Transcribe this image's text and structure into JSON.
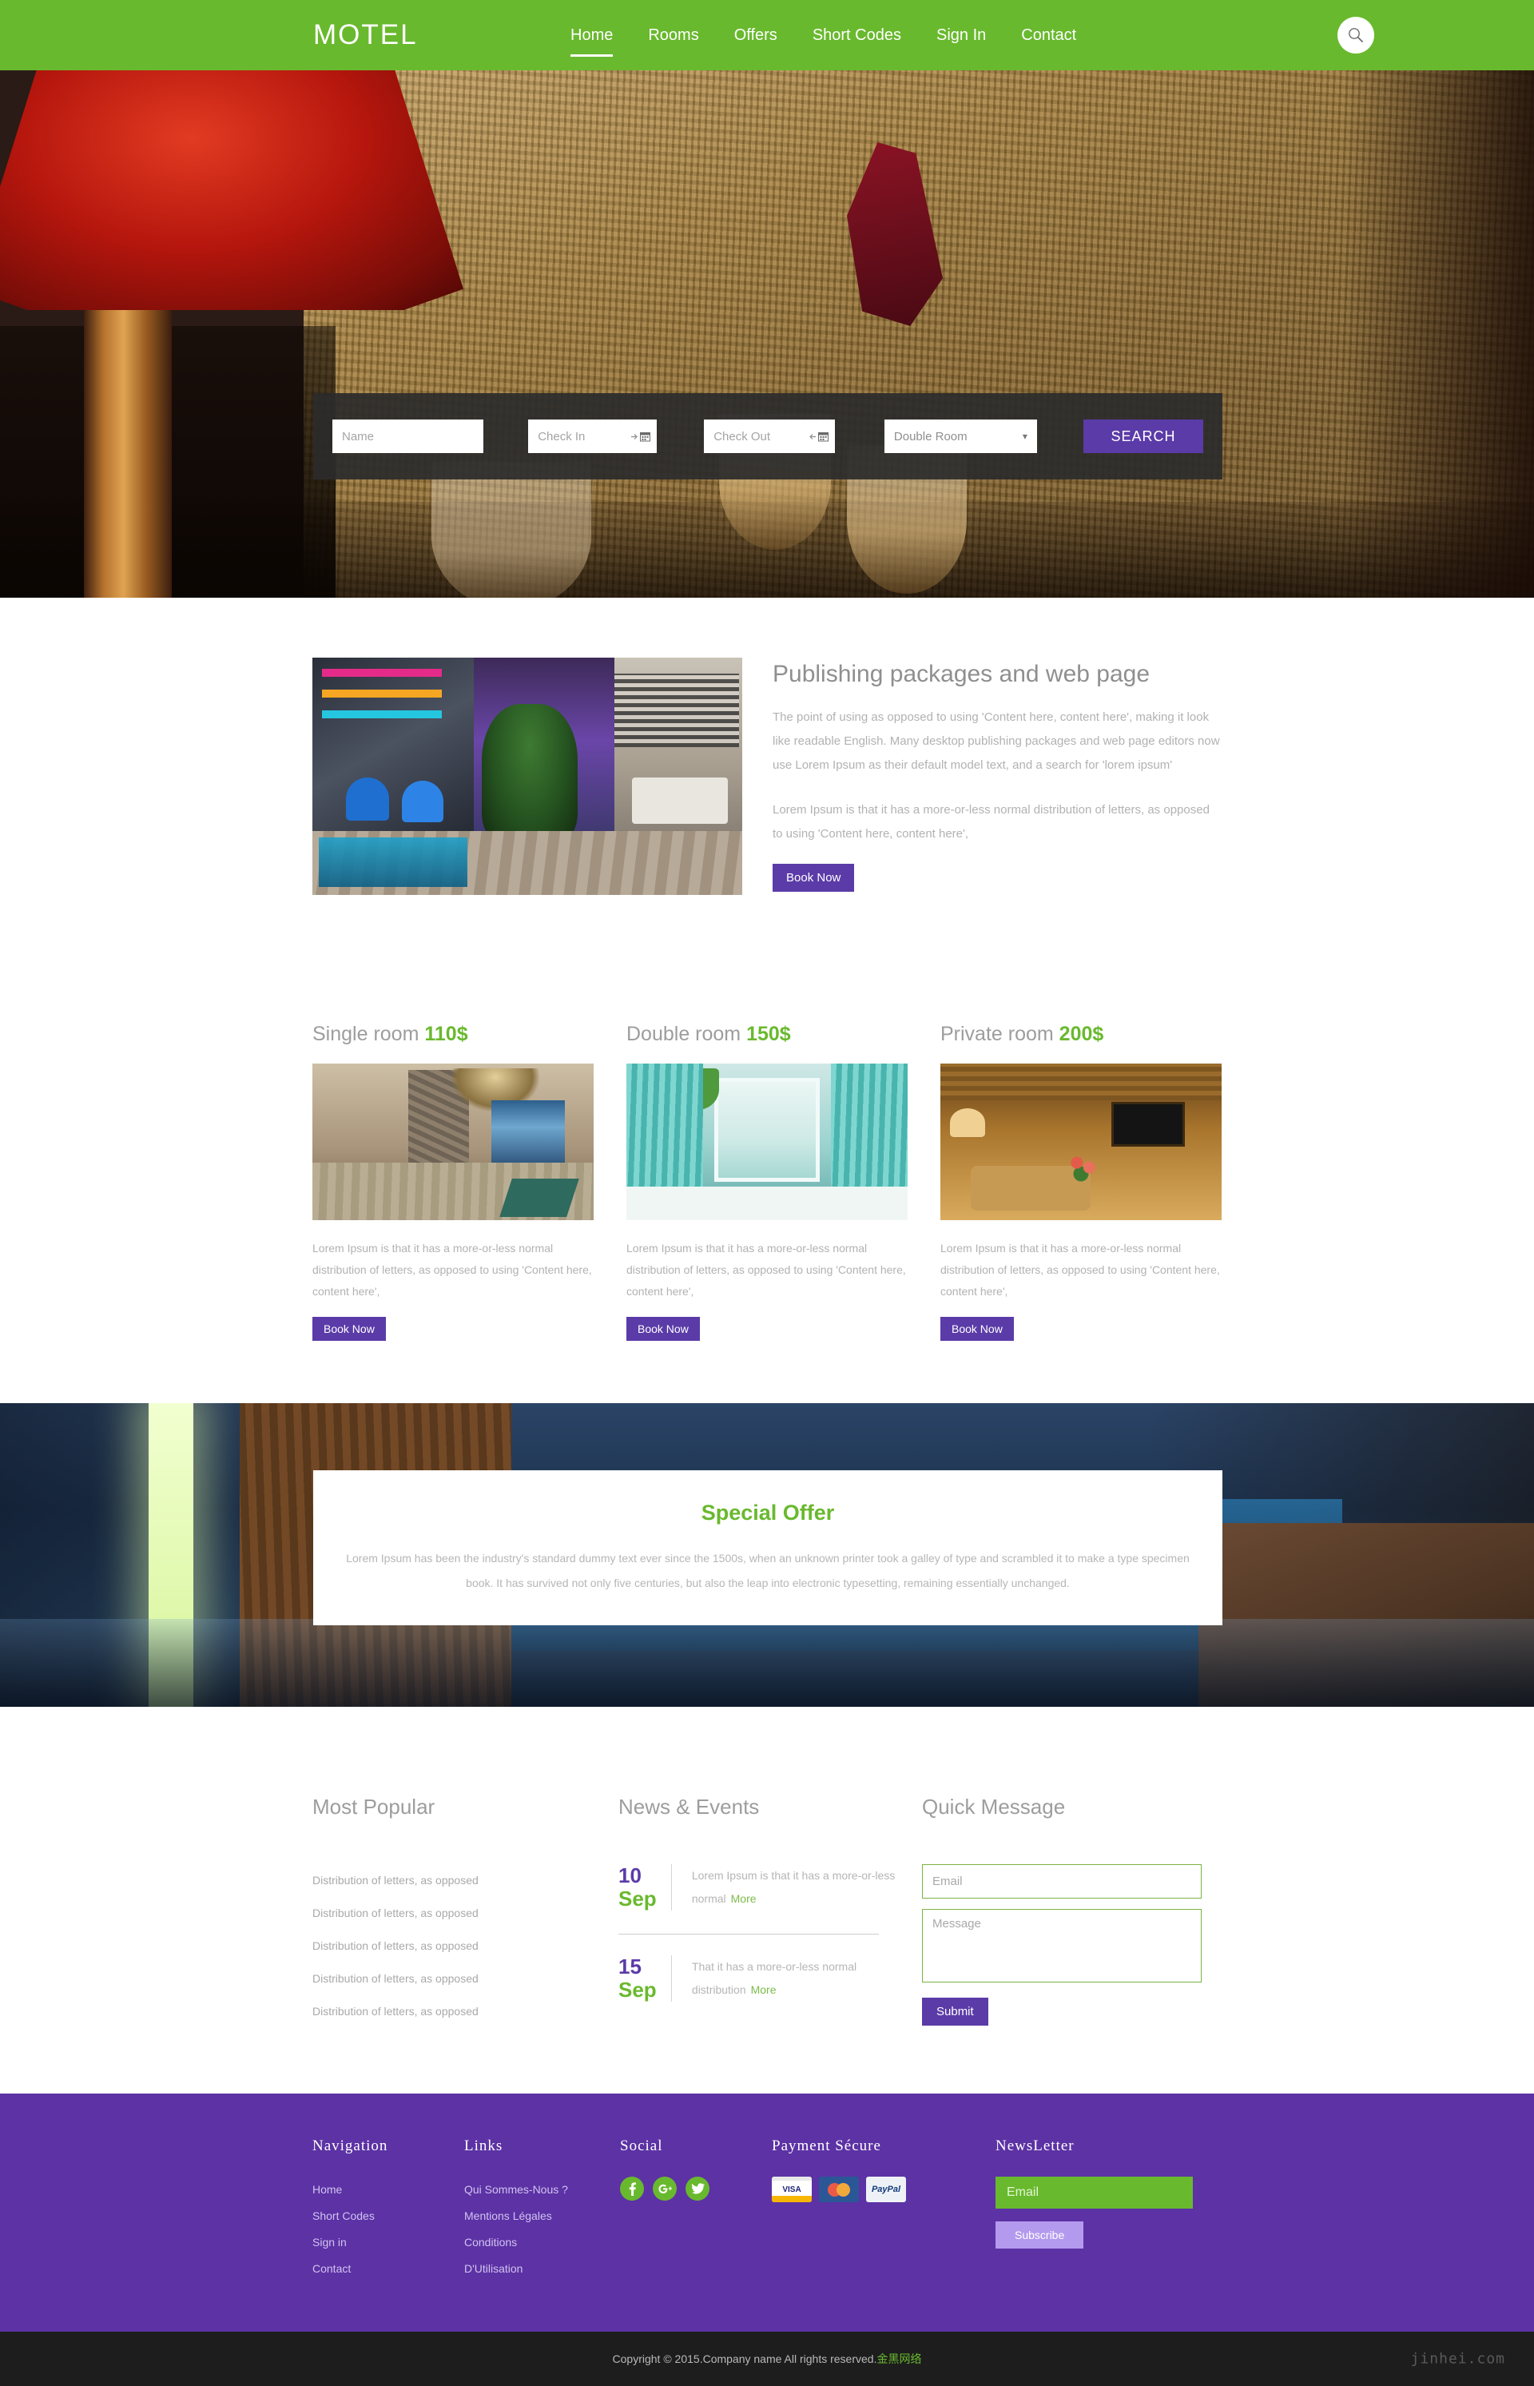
{
  "header": {
    "brand": "MOTEL",
    "nav": [
      {
        "label": "Home",
        "active": true
      },
      {
        "label": "Rooms",
        "active": false
      },
      {
        "label": "Offers",
        "active": false
      },
      {
        "label": "Short Codes",
        "active": false
      },
      {
        "label": "Sign In",
        "active": false
      },
      {
        "label": "Contact",
        "active": false
      }
    ],
    "search_icon": "search-icon",
    "accent_green": "#69b92e"
  },
  "booking": {
    "name_placeholder": "Name",
    "checkin_placeholder": "Check In",
    "checkout_placeholder": "Check Out",
    "room_selected": "Double Room",
    "room_options": [
      "Double Room"
    ],
    "search_label": "SEARCH",
    "calendar_icon": "calendar-icon",
    "chevron_icon": "chevron-down-icon"
  },
  "about": {
    "title": "Publishing packages and web page",
    "paragraph1": "The point of using as opposed to using 'Content here, content here', making it look like readable English. Many desktop publishing packages and web page editors now use Lorem Ipsum as their default model text, and a search for 'lorem ipsum'",
    "paragraph2": "Lorem Ipsum is that it has a more-or-less normal distribution of letters, as opposed to using 'Content here, content here',",
    "book_label": "Book Now"
  },
  "rooms": [
    {
      "name": "Single room",
      "price": "110$",
      "desc": "Lorem Ipsum is that it has a more-or-less normal distribution of letters, as opposed to using 'Content here, content here',",
      "book_label": "Book Now"
    },
    {
      "name": "Double room",
      "price": "150$",
      "desc": "Lorem Ipsum is that it has a more-or-less normal distribution of letters, as opposed to using 'Content here, content here',",
      "book_label": "Book Now"
    },
    {
      "name": "Private room",
      "price": "200$",
      "desc": "Lorem Ipsum is that it has a more-or-less normal distribution of letters, as opposed to using 'Content here, content here',",
      "book_label": "Book Now"
    }
  ],
  "special_offer": {
    "title": "Special Offer",
    "text": "Lorem Ipsum has been the industry's standard dummy text ever since the 1500s, when an unknown printer took a galley of type and scrambled it to make a type specimen book. It has survived not only five centuries, but also the leap into electronic typesetting, remaining essentially unchanged."
  },
  "most_popular": {
    "title": "Most Popular",
    "items": [
      "Distribution of letters, as opposed",
      "Distribution of letters, as opposed",
      "Distribution of letters, as opposed",
      "Distribution of letters, as opposed",
      "Distribution of letters, as opposed"
    ]
  },
  "news": {
    "title": "News & Events",
    "items": [
      {
        "day": "10",
        "month": "Sep",
        "text": "Lorem Ipsum is that it has a more-or-less normal",
        "more": "More"
      },
      {
        "day": "15",
        "month": "Sep",
        "text": "That it has a more-or-less normal distribution",
        "more": "More"
      }
    ]
  },
  "quick_message": {
    "title": "Quick Message",
    "email_placeholder": "Email",
    "message_placeholder": "Message",
    "submit_label": "Submit"
  },
  "footer": {
    "navigation": {
      "title": "Navigation",
      "links": [
        "Home",
        "Short Codes",
        "Sign in",
        "Contact"
      ]
    },
    "links": {
      "title": "Links",
      "links": [
        "Qui Sommes-Nous ?",
        "Mentions Légales",
        "Conditions",
        "D'Utilisation"
      ]
    },
    "social": {
      "title": "Social",
      "icons": [
        "facebook-icon",
        "google-plus-icon",
        "twitter-icon"
      ]
    },
    "payment": {
      "title": "Payment Sécure",
      "methods": [
        "VISA",
        "MasterCard",
        "PayPal"
      ]
    },
    "newsletter": {
      "title": "NewsLetter",
      "email_placeholder": "Email",
      "subscribe_label": "Subscribe"
    },
    "brand_purple": "#5c32a5"
  },
  "copyright": {
    "text": "Copyright © 2015.Company name All rights reserved.",
    "cn_text": "金黑网络",
    "watermark": "jinhei.com"
  }
}
